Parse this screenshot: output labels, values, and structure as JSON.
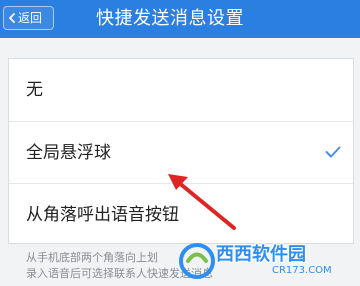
{
  "header": {
    "back_label": "返回",
    "title": "快捷发送消息设置",
    "background_color": "#2b7fe0"
  },
  "options": [
    {
      "label": "无",
      "selected": false
    },
    {
      "label": "全局悬浮球",
      "selected": true
    },
    {
      "label": "从角落呼出语音按钮",
      "selected": false
    }
  ],
  "hint": {
    "line1": "从手机底部两个角落向上划",
    "line2": "录入语音后可选择联系人快速发送消息"
  },
  "watermark": {
    "brand": "西西软件园",
    "url": "CR173.COM"
  },
  "colors": {
    "accent": "#2b7fe0",
    "check": "#4a8fe6",
    "arrow": "#e02424"
  }
}
